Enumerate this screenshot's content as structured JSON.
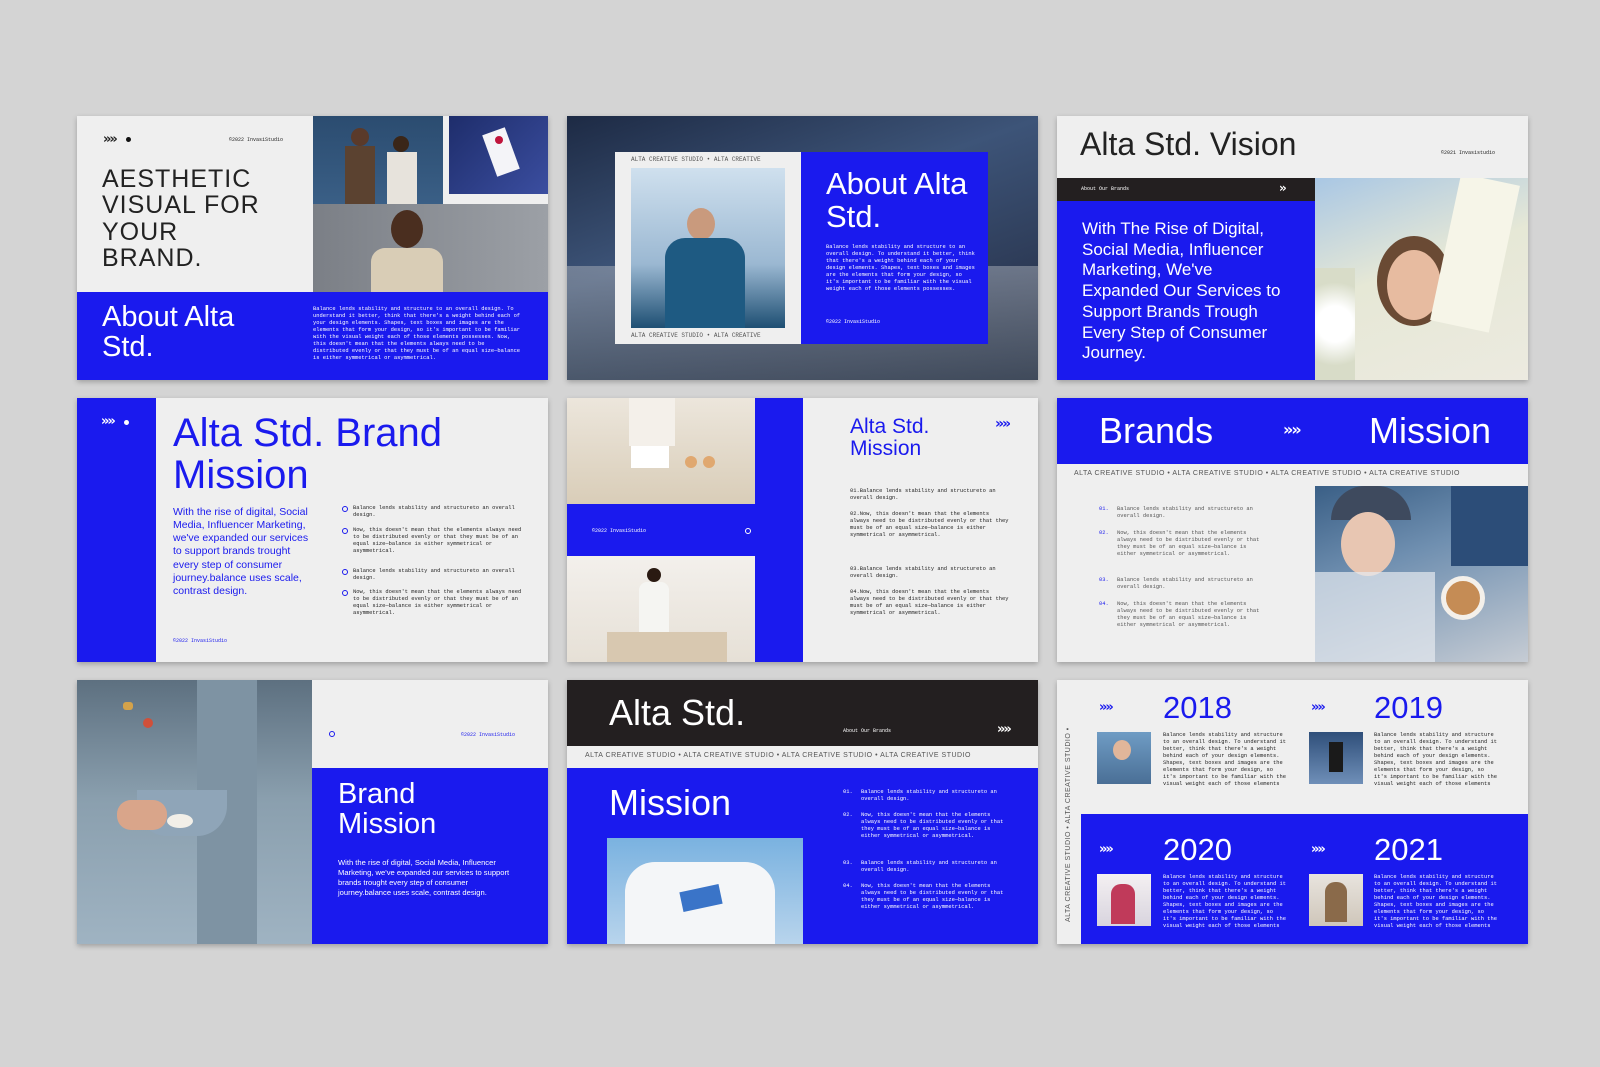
{
  "s1": {
    "copyright": "©2022 InvasiStudio",
    "headline": "AESTHETIC VISUAL FOR YOUR BRAND.",
    "title": "About Alta Std.",
    "body": "Balance lends stability and structure to an overall design. To understand it better, think that there's a weight behind each of your design elements. Shapes, text boxes and images are the elements that form your design, so it's important to be familiar with the visual weight each of those elements possesses. Now, this doesn't mean that the elements always need to be distributed evenly or that they must be of an equal size—balance is either symmetrical or asymmetrical."
  },
  "s2": {
    "frame_label": "ALTA CREATIVE STUDIO • ALTA CREATIVE",
    "title": "About Alta Std.",
    "body": "Balance lends stability and structure to an overall design. To understand it better, think that there's a weight behind each of your design elements. Shapes, text boxes and images are the elements that form your design, so it's important to be familiar with the visual weight each of those elements possesses.",
    "copyright": "©2022 InvasiStudio"
  },
  "s3": {
    "title": "Alta Std. Vision",
    "copyright": "©2021 Invasistudio",
    "bar_label": "About Our Brands",
    "body": "With The Rise of Digital, Social Media, Influencer Marketing, We've Expanded Our Services to Support Brands Trough Every Step of Consumer Journey."
  },
  "s4": {
    "title": "Alta Std. Brand Mission",
    "body": "With the rise of digital, Social Media, Influencer Marketing, we've expanded our services to support brands trought every step of consumer journey.balance uses scale, contrast design.",
    "bullets": [
      "Balance lends stability and structureto an overall design.",
      "Now, this doesn't mean that the elements always need to be distributed evenly or that they must be of an equal size—balance is either symmetrical or asymmetrical.",
      "Balance lends stability and structureto an overall design.",
      "Now, this doesn't mean that the elements always need to be distributed evenly or that they must be of an equal size—balance is either symmetrical or asymmetrical."
    ],
    "copyright": "©2022 InvasiStudio"
  },
  "s5": {
    "copyright": "©2022 InvasiStudio",
    "title": "Alta Std. Mission",
    "items": [
      "01.Balance lends stability and structureto an overall design.",
      "02.Now, this doesn't mean that the elements always need to be distributed evenly or that they must be of an equal size—balance is either symmetrical or asymmetrical.",
      "03.Balance lends stability and structureto an overall design.",
      "04.Now, this doesn't mean that the elements always need to be distributed evenly or that they must be of an equal size—balance is either symmetrical or asymmetrical."
    ]
  },
  "s6": {
    "left": "Brands",
    "right": "Mission",
    "strip": "ALTA CREATIVE STUDIO • ALTA CREATIVE STUDIO • ALTA CREATIVE STUDIO • ALTA CREATIVE STUDIO",
    "items": [
      {
        "num": "01.",
        "text": "Balance lends stability and structureto an overall design."
      },
      {
        "num": "02.",
        "text": "Now, this doesn't mean that the elements always need to be distributed evenly or that they must be of an equal size—balance is either symmetrical or asymmetrical."
      },
      {
        "num": "03.",
        "text": "Balance lends stability and structureto an overall design."
      },
      {
        "num": "04.",
        "text": "Now, this doesn't mean that the elements always need to be distributed evenly or that they must be of an equal size—balance is either symmetrical or asymmetrical."
      }
    ]
  },
  "s7": {
    "copyright": "©2022 InvasiStudio",
    "title": "Brand Mission",
    "body": "With the rise of digital, Social Media, Influencer Marketing, we've expanded our services to support brands trought every step of consumer journey.balance uses scale, contrast design."
  },
  "s8": {
    "title": "Alta Std.",
    "bar_label": "About Our Brands",
    "strip": "ALTA CREATIVE STUDIO • ALTA CREATIVE STUDIO • ALTA CREATIVE STUDIO • ALTA CREATIVE STUDIO",
    "subtitle": "Mission",
    "items": [
      {
        "num": "01.",
        "text": "Balance lends stability and structureto an overall design."
      },
      {
        "num": "02.",
        "text": "Now, this doesn't mean that the elements always need to be distributed evenly or that they must be of an equal size—balance is either symmetrical or asymmetrical."
      },
      {
        "num": "03.",
        "text": "Balance lends stability and structureto an overall design."
      },
      {
        "num": "04.",
        "text": "Now, this doesn't mean that the elements always need to be distributed evenly or that they must be of an equal size—balance is either symmetrical or asymmetrical."
      }
    ]
  },
  "s9": {
    "vertical": "ALTA CREATIVE STUDIO • ALTA CREATIVE STUDIO •",
    "years": [
      {
        "year": "2018",
        "text": "Balance lends stability and structure to an overall design. To understand it better, think that there's a weight behind each of your design elements. Shapes, text boxes and images are the elements that form your design, so it's important to be familiar with the visual weight each of those elements"
      },
      {
        "year": "2019",
        "text": "Balance lends stability and structure to an overall design. To understand it better, think that there's a weight behind each of your design elements. Shapes, text boxes and images are the elements that form your design, so it's important to be familiar with the visual weight each of those elements"
      },
      {
        "year": "2020",
        "text": "Balance lends stability and structure to an overall design. To understand it better, think that there's a weight behind each of your design elements. Shapes, text boxes and images are the elements that form your design, so it's important to be familiar with the visual weight each of those elements"
      },
      {
        "year": "2021",
        "text": "Balance lends stability and structure to an overall design. To understand it better, think that there's a weight behind each of your design elements. Shapes, text boxes and images are the elements that form your design, so it's important to be familiar with the visual weight each of those elements"
      }
    ]
  },
  "colors": {
    "accent": "#1a1aee",
    "dark": "#231f20",
    "light": "#efefef",
    "background": "#d4d4d4"
  },
  "icons": [
    "double-chevron-icon",
    "dot-icon",
    "ring-icon"
  ]
}
